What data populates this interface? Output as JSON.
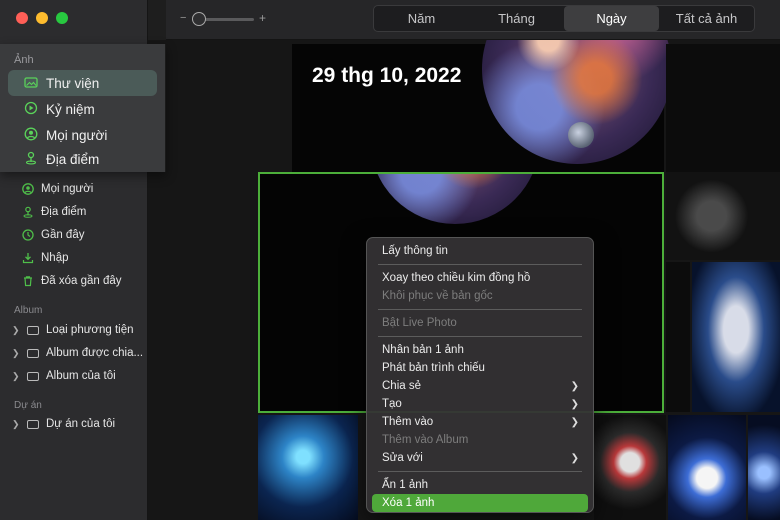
{
  "sidebar": {
    "section_photos": "Ảnh",
    "items": [
      {
        "label": "Mọi người",
        "icon": "person-icon"
      },
      {
        "label": "Địa điểm",
        "icon": "pin-icon"
      },
      {
        "label": "Gần đây",
        "icon": "clock-icon"
      },
      {
        "label": "Nhập",
        "icon": "import-icon"
      },
      {
        "label": "Đã xóa gần đây",
        "icon": "trash-icon"
      }
    ],
    "section_album": "Album",
    "albums": [
      "Loại phương tiện",
      "Album được chia...",
      "Album của tôi"
    ],
    "section_projects": "Dự án",
    "projects": [
      "Dự án của tôi"
    ]
  },
  "zoom_panel": {
    "label": "Ảnh",
    "items": [
      {
        "label": "Thư viện",
        "icon": "library-icon",
        "selected": true
      },
      {
        "label": "Kỷ niệm",
        "icon": "memories-icon",
        "selected": false
      },
      {
        "label": "Mọi người",
        "icon": "person-icon",
        "selected": false
      },
      {
        "label": "Địa điểm",
        "icon": "pin-icon",
        "selected": false
      }
    ]
  },
  "toolbar": {
    "zoom_minus": "−",
    "zoom_plus": "+",
    "tabs": [
      {
        "label": "Năm",
        "active": false
      },
      {
        "label": "Tháng",
        "active": false
      },
      {
        "label": "Ngày",
        "active": true
      },
      {
        "label": "Tất cả ảnh",
        "active": false
      }
    ]
  },
  "main": {
    "date_title": "29 thg 10, 2022"
  },
  "context_menu": {
    "groups": [
      [
        {
          "label": "Lấy thông tin"
        }
      ],
      [
        {
          "label": "Xoay theo chiều kim đồng hồ"
        },
        {
          "label": "Khôi phục về bản gốc",
          "disabled": true
        }
      ],
      [
        {
          "label": "Bật Live Photo",
          "disabled": true
        }
      ],
      [
        {
          "label": "Nhân bản 1 ảnh"
        },
        {
          "label": "Phát bản trình chiếu"
        },
        {
          "label": "Chia sẻ",
          "submenu": true
        },
        {
          "label": "Tạo",
          "submenu": true
        },
        {
          "label": "Thêm vào",
          "submenu": true
        },
        {
          "label": "Thêm vào Album",
          "disabled": true
        },
        {
          "label": "Sửa với",
          "submenu": true
        }
      ],
      [
        {
          "label": "Ẩn 1 ảnh"
        },
        {
          "label": "Xóa 1 ảnh",
          "highlight": true
        }
      ]
    ]
  },
  "colors": {
    "accent_green": "#4fa83a",
    "selection_border": "#4cae3a"
  }
}
